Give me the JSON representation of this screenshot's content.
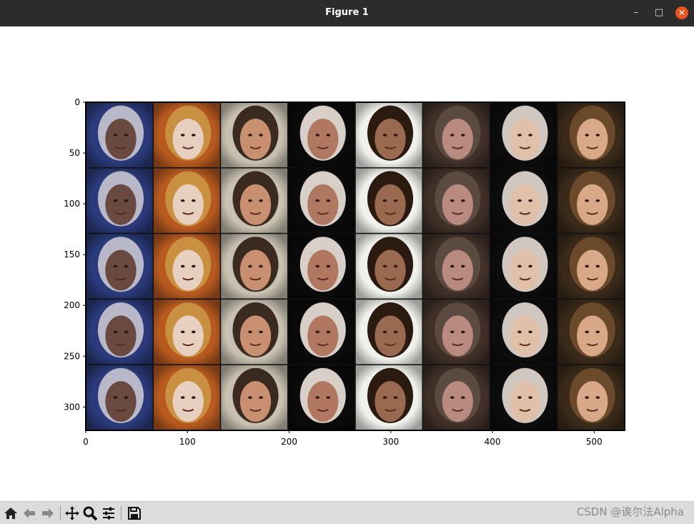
{
  "window": {
    "title": "Figure 1",
    "minimize_glyph": "–",
    "maximize_glyph": "□",
    "close_glyph": "✕"
  },
  "toolbar": {
    "items": [
      "home-icon",
      "back-icon",
      "forward-icon",
      "pan-icon",
      "zoom-icon",
      "configure-subplots-icon",
      "save-icon"
    ],
    "watermark": "CSDN @诶尔法Alpha"
  },
  "chart_data": {
    "type": "image",
    "title": "",
    "xlabel": "",
    "ylabel": "",
    "xlim": [
      0,
      530
    ],
    "ylim": [
      323,
      0
    ],
    "xticks": [
      0,
      100,
      200,
      300,
      400,
      500
    ],
    "yticks": [
      0,
      50,
      100,
      150,
      200,
      250,
      300
    ],
    "grid": {
      "rows": 5,
      "cols": 8
    },
    "tiles": [
      {
        "bg": "#2a3a7a",
        "hair": "#b8b8c8",
        "skin": "#6a4a40"
      },
      {
        "bg": "#b85a20",
        "hair": "#c89040",
        "skin": "#e8d0c0"
      },
      {
        "bg": "#c8c0b0",
        "hair": "#3a2a20",
        "skin": "#c89070"
      },
      {
        "bg": "#0a0a0a",
        "hair": "#d8d0c8",
        "skin": "#b07860"
      },
      {
        "bg": "#f0f0ec",
        "hair": "#2a1a10",
        "skin": "#9a6a50"
      },
      {
        "bg": "#403028",
        "hair": "#5a4a40",
        "skin": "#b88a80"
      },
      {
        "bg": "#0c0c0c",
        "hair": "#d0c8c0",
        "skin": "#e0c0a8"
      },
      {
        "bg": "#3a2a1a",
        "hair": "#6a4a2a",
        "skin": "#d8a888"
      }
    ]
  }
}
